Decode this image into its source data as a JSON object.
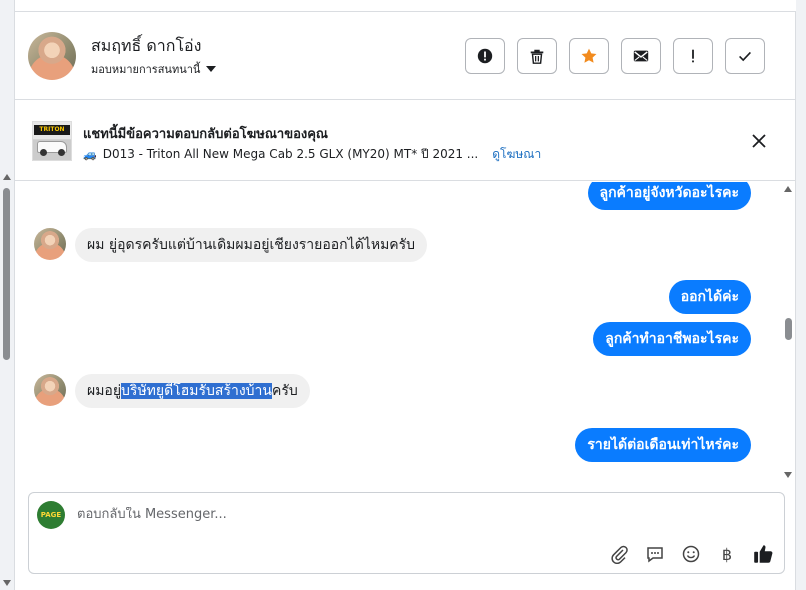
{
  "contact": {
    "name": "สมฤทธิ์ ดากโอ่ง",
    "assign_label": "มอบหมายการสนทนานี้"
  },
  "header_actions": [
    {
      "id": "report",
      "icon": "alert-circle-icon"
    },
    {
      "id": "delete",
      "icon": "trash-icon"
    },
    {
      "id": "star",
      "icon": "star-icon",
      "color": "#f28b1e"
    },
    {
      "id": "mark-unread",
      "icon": "envelope-icon"
    },
    {
      "id": "spam",
      "icon": "exclamation-icon"
    },
    {
      "id": "done",
      "icon": "check-icon"
    }
  ],
  "ad_banner": {
    "title": "แชทนี้มีข้อความตอบกลับต่อโฆษณาของคุณ",
    "thumb_brand": "TRITON",
    "ad_text": "D013 - Triton All New Mega Cab 2.5 GLX (MY20) MT* ปี 2021 ...",
    "link": "ดูโฆษณา"
  },
  "messages": [
    {
      "dir": "out",
      "text": "ลูกค้าอยู่จังหวัดอะไรคะ"
    },
    {
      "dir": "in",
      "text": "ผม ยู่อุดรครับแต่บ้านเดิมผมอยู่เชียงรายออกได้ไหมครับ"
    },
    {
      "dir": "out",
      "text": "ออกได้ค่ะ"
    },
    {
      "dir": "out",
      "text": "ลูกค้าทำอาชีพอะไรคะ"
    },
    {
      "dir": "in",
      "pre": "ผมอยู่",
      "highlight": "บริษัทยูดีโฮมรับสร้างบ้าน",
      "post": "ครับ"
    },
    {
      "dir": "out",
      "text": "รายได้ต่อเดือนเท่าไหร่คะ"
    }
  ],
  "composer": {
    "placeholder": "ตอบกลับใน Messenger...",
    "value": "",
    "page_avatar_text": "PAGE"
  },
  "colors": {
    "accent": "#0a7cff",
    "star": "#f28b1e",
    "link": "#1d6fc1",
    "selection": "#2f6fd1"
  }
}
